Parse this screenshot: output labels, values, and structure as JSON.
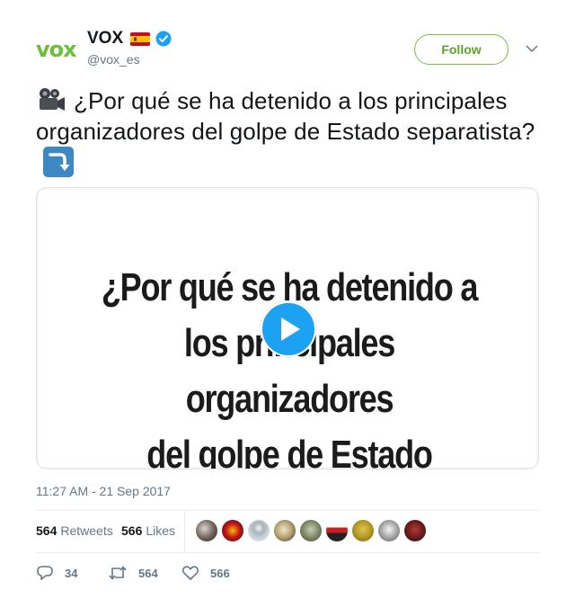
{
  "header": {
    "logo_text": "vox",
    "name": "VOX",
    "handle": "@vox_es",
    "follow_label": "Follow",
    "colors": {
      "logo": "#6bbf3b",
      "follow": "#5ba32c",
      "verified": "#1da1f2"
    }
  },
  "tweet": {
    "text": "¿Por qué se ha detenido a los principales organizadores del golpe de Estado separatista?",
    "leading_emoji": "movie-camera-icon",
    "trailing_emoji": "arrow-curving-down-icon"
  },
  "media": {
    "video_title_line1": "¿Por qué se ha detenido a",
    "video_title_line2": "los principales organizadores",
    "video_title_line3": "del golpe de Estado separatista?"
  },
  "timestamp": "11:27 AM - 21 Sep 2017",
  "stats": {
    "retweets_count": "564",
    "retweets_label": "Retweets",
    "likes_count": "566",
    "likes_label": "Likes",
    "avatar_count": 9
  },
  "actions": {
    "replies": "34",
    "retweets": "564",
    "likes": "566"
  }
}
